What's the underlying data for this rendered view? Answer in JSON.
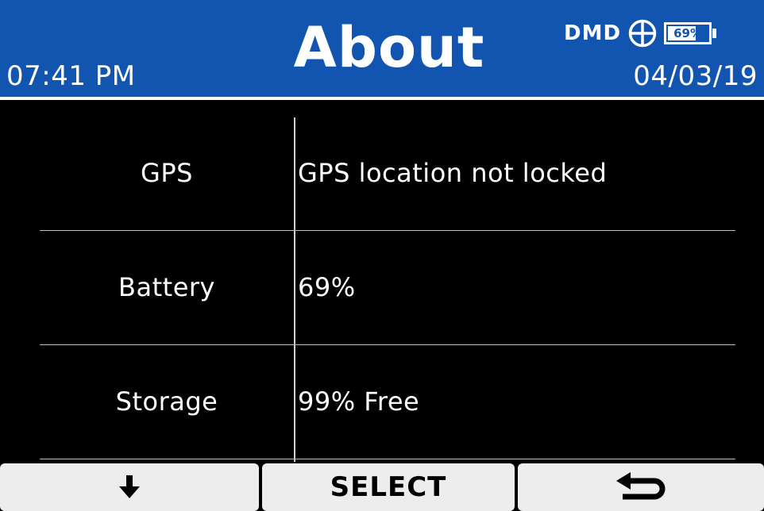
{
  "header": {
    "time": "07:41 PM",
    "title": "About",
    "date": "04/03/19",
    "status": {
      "mode": "DMD",
      "gps_icon": "gps-crosshair-icon",
      "battery_label": "69%",
      "battery_level": 0.69
    }
  },
  "info": {
    "rows": [
      {
        "label": "GPS",
        "value": "GPS location not locked"
      },
      {
        "label": "Battery",
        "value": "69%"
      },
      {
        "label": "Storage",
        "value": "99% Free"
      }
    ]
  },
  "softkeys": {
    "left_icon": "arrow-down-icon",
    "center_label": "SELECT",
    "right_icon": "back-arrow-icon"
  },
  "colors": {
    "header_bg": "#1155b0",
    "screen_bg": "#000000",
    "softkey_bg": "#ededed",
    "text": "#ffffff"
  }
}
